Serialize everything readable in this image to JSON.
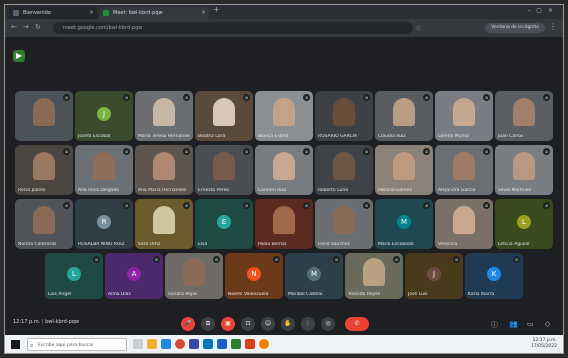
{
  "browser": {
    "tabs": [
      {
        "label": "Bienvenido",
        "color": "#5f6368"
      },
      {
        "label": "Meet: bwl-kbrd-pqw",
        "color": "#1e8e3e"
      }
    ],
    "url": "meet.google.com/bwl-kbrd-pqw",
    "extension_label": "Ventana de incógnito"
  },
  "participants": [
    {
      "name": "",
      "kind": "video",
      "tile": "#4a5258",
      "skin": "#8a6a55",
      "muted": true
    },
    {
      "name": "Josefa Escobar",
      "kind": "avatar",
      "tile": "#3a4a2c",
      "avatar_color": "#7cb342",
      "initial": "J",
      "muted": true
    },
    {
      "name": "María Teresa Hernández",
      "kind": "video",
      "tile": "#6b6e70",
      "skin": "#c9b7a6",
      "muted": true
    },
    {
      "name": "Beatriz Lara",
      "kind": "video",
      "tile": "#5a4a3c",
      "skin": "#d8c7b5",
      "muted": true
    },
    {
      "name": "Blanca Estela",
      "kind": "video",
      "tile": "#8a8f93",
      "skin": "#c2a38a",
      "muted": true
    },
    {
      "name": "ROSARIO GARCIA",
      "kind": "video",
      "tile": "#3d4045",
      "skin": "#6a4c3a",
      "muted": true
    },
    {
      "name": "Claudia Ruiz",
      "kind": "video",
      "tile": "#585c60",
      "skin": "#b89c84",
      "muted": true
    },
    {
      "name": "Lorena Muñoz",
      "kind": "video",
      "tile": "#777d82",
      "skin": "#c6a890",
      "muted": true
    },
    {
      "name": "Juan Carlos",
      "kind": "video",
      "tile": "#5a5e62",
      "skin": "#a0806a",
      "muted": true
    },
    {
      "name": "Rocío Juárez",
      "kind": "video",
      "tile": "#4b4640",
      "skin": "#9a7862",
      "muted": true
    },
    {
      "name": "Ana Rosa Delgado",
      "kind": "video",
      "tile": "#6b7075",
      "skin": "#8f6c58",
      "muted": true
    },
    {
      "name": "Ana María Hernández",
      "kind": "video",
      "tile": "#5c5550",
      "skin": "#b08870",
      "muted": true
    },
    {
      "name": "Ernesto Pérez",
      "kind": "video",
      "tile": "#4a4e52",
      "skin": "#7a5a48",
      "muted": true
    },
    {
      "name": "Carmen Ruiz",
      "kind": "video",
      "tile": "#787c80",
      "skin": "#c8a890",
      "muted": true
    },
    {
      "name": "Roberto Luna",
      "kind": "video",
      "tile": "#3f4347",
      "skin": "#6e5646",
      "muted": true
    },
    {
      "name": "Patricia Gómez",
      "kind": "video",
      "tile": "#8a8278",
      "skin": "#c09a80",
      "muted": true
    },
    {
      "name": "Alejandra García",
      "kind": "video",
      "tile": "#6a6f73",
      "skin": "#9c7a64",
      "muted": true
    },
    {
      "name": "Silvia Martínez",
      "kind": "video",
      "tile": "#7a7e82",
      "skin": "#b89880",
      "muted": true
    },
    {
      "name": "Norma Contreras",
      "kind": "video",
      "tile": "#505458",
      "skin": "#8a6a56",
      "muted": true
    },
    {
      "name": "ROSALBA NIÑO RUIZ",
      "kind": "avatar",
      "tile": "#2f3d45",
      "avatar_color": "#78909c",
      "initial": "R",
      "muted": true
    },
    {
      "name": "Sara Ortiz",
      "kind": "video",
      "tile": "#6b5a2c",
      "skin": "#cfc6a0",
      "muted": true
    },
    {
      "name": "Elsa",
      "kind": "avatar",
      "tile": "#1f4a44",
      "avatar_color": "#26a69a",
      "initial": "E",
      "muted": true
    },
    {
      "name": "Paola Bernal",
      "kind": "video",
      "tile": "#5b2a20",
      "skin": "#a0684c",
      "muted": true
    },
    {
      "name": "Irene Sánchez",
      "kind": "video",
      "tile": "#6a6e72",
      "skin": "#8a6a56",
      "muted": true
    },
    {
      "name": "Mario Escobedo",
      "kind": "avatar",
      "tile": "#1f4850",
      "avatar_color": "#00838f",
      "initial": "M",
      "muted": true
    },
    {
      "name": "Verónica",
      "kind": "video",
      "tile": "#7a7066",
      "skin": "#c8a890",
      "muted": true
    },
    {
      "name": "Leticia Aguilar",
      "kind": "avatar",
      "tile": "#3b4a1c",
      "avatar_color": "#9e9d24",
      "initial": "L",
      "muted": true
    },
    {
      "name": "Luis Ángel",
      "kind": "avatar",
      "tile": "#1f4a44",
      "avatar_color": "#26a69a",
      "initial": "L",
      "muted": true
    },
    {
      "name": "Alma Díaz",
      "kind": "avatar",
      "tile": "#4a2a6a",
      "avatar_color": "#8e24aa",
      "initial": "A",
      "muted": true
    },
    {
      "name": "Sandra Rojas",
      "kind": "video",
      "tile": "#6e6a66",
      "skin": "#8a6a56",
      "muted": true
    },
    {
      "name": "Noemí Valenzuela",
      "kind": "avatar",
      "tile": "#6a3a1a",
      "avatar_color": "#f4511e",
      "initial": "N",
      "muted": true
    },
    {
      "name": "Maribel Castillo",
      "kind": "avatar",
      "tile": "#2c3f4a",
      "avatar_color": "#546e7a",
      "initial": "M",
      "muted": true
    },
    {
      "name": "Yolanda Reyes",
      "kind": "video",
      "tile": "#6a6a5a",
      "skin": "#b8a080",
      "muted": true
    },
    {
      "name": "José Luis",
      "kind": "avatar",
      "tile": "#4a3a1c",
      "avatar_color": "#6d4c41",
      "initial": "J",
      "muted": true
    },
    {
      "name": "Karla Ibarra",
      "kind": "avatar",
      "tile": "#1f3a55",
      "avatar_color": "#1e88e5",
      "initial": "K",
      "muted": true
    }
  ],
  "call": {
    "time": "12:17 p.m.",
    "meeting_code": "bwl-kbrd-pqw"
  },
  "taskbar": {
    "search_placeholder": "Escribe aquí para buscar",
    "time": "12:17 p.m.",
    "date": "17/05/2022"
  }
}
